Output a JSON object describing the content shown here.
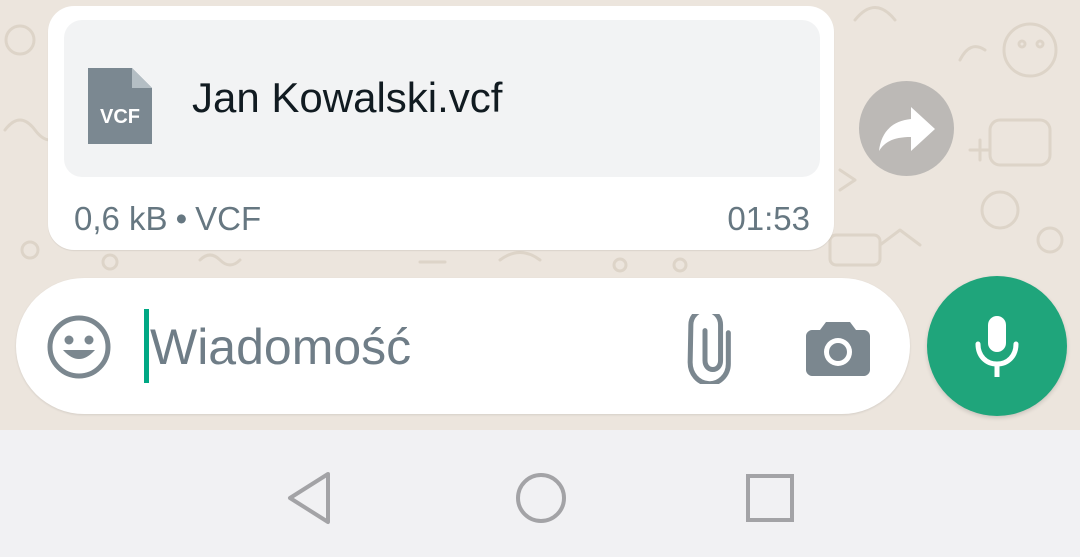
{
  "message": {
    "file_type_badge": "VCF",
    "file_name": "Jan Kowalski.vcf",
    "file_size": "0,6 kB",
    "separator": "•",
    "file_type": "VCF",
    "time": "01:53"
  },
  "composer": {
    "placeholder": "Wiadomość",
    "value": ""
  },
  "icons": {
    "doc": "vcf-document-icon",
    "forward": "forward-icon",
    "emoji": "emoji-icon",
    "attach": "paperclip-icon",
    "camera": "camera-icon",
    "mic": "microphone-icon",
    "nav_back": "back-triangle-icon",
    "nav_home": "home-circle-icon",
    "nav_recents": "recents-square-icon"
  },
  "colors": {
    "accent": "#1fa57b",
    "chat_background": "#ece5dd",
    "bubble": "#ffffff",
    "meta_text": "#667781"
  }
}
